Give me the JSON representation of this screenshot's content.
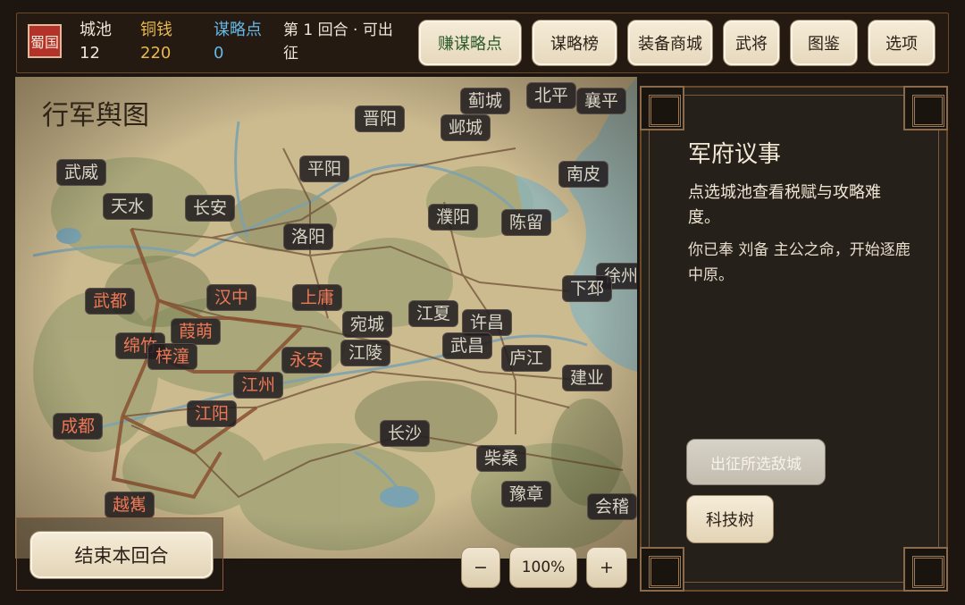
{
  "topbar": {
    "faction": "蜀国",
    "cities_label": "城池",
    "cities_value": "12",
    "coins_label": "铜钱",
    "coins_value": "220",
    "strategy_label": "谋略点",
    "strategy_value": "0",
    "turn_text": "第 1 回合 · 可出征",
    "buttons": {
      "earn": "赚谋略点",
      "rank": "谋略榜",
      "shop": "装备商城",
      "generals": "武将",
      "atlas": "图鉴",
      "options": "选项"
    }
  },
  "map": {
    "title": "行军舆图",
    "cities": [
      {
        "name": "蓟城",
        "side": "neutral"
      },
      {
        "name": "北平",
        "side": "neutral"
      },
      {
        "name": "襄平",
        "side": "neutral"
      },
      {
        "name": "晋阳",
        "side": "neutral"
      },
      {
        "name": "邺城",
        "side": "neutral"
      },
      {
        "name": "平阳",
        "side": "neutral"
      },
      {
        "name": "南皮",
        "side": "neutral"
      },
      {
        "name": "武威",
        "side": "neutral"
      },
      {
        "name": "天水",
        "side": "neutral"
      },
      {
        "name": "长安",
        "side": "neutral"
      },
      {
        "name": "洛阳",
        "side": "neutral"
      },
      {
        "name": "濮阳",
        "side": "neutral"
      },
      {
        "name": "陈留",
        "side": "neutral"
      },
      {
        "name": "徐州",
        "side": "neutral"
      },
      {
        "name": "下邳",
        "side": "neutral"
      },
      {
        "name": "武都",
        "side": "own"
      },
      {
        "name": "汉中",
        "side": "own"
      },
      {
        "name": "上庸",
        "side": "own"
      },
      {
        "name": "宛城",
        "side": "neutral"
      },
      {
        "name": "江夏",
        "side": "neutral"
      },
      {
        "name": "许昌",
        "side": "neutral"
      },
      {
        "name": "葭萌",
        "side": "own"
      },
      {
        "name": "绵竹",
        "side": "own"
      },
      {
        "name": "梓潼",
        "side": "own"
      },
      {
        "name": "永安",
        "side": "own"
      },
      {
        "name": "江陵",
        "side": "neutral"
      },
      {
        "name": "武昌",
        "side": "neutral"
      },
      {
        "name": "庐江",
        "side": "neutral"
      },
      {
        "name": "建业",
        "side": "neutral"
      },
      {
        "name": "江州",
        "side": "own"
      },
      {
        "name": "江阳",
        "side": "own"
      },
      {
        "name": "成都",
        "side": "own"
      },
      {
        "name": "长沙",
        "side": "neutral"
      },
      {
        "name": "柴桑",
        "side": "neutral"
      },
      {
        "name": "豫章",
        "side": "neutral"
      },
      {
        "name": "会稽",
        "side": "neutral"
      },
      {
        "name": "越嶲",
        "side": "own"
      }
    ]
  },
  "end_turn": "结束本回合",
  "zoom": {
    "out": "−",
    "level": "100%",
    "in": "+"
  },
  "panel": {
    "title": "军府议事",
    "hint": "点选城池查看税赋与攻略难度。",
    "message": "你已奉 刘备 主公之命，开始逐鹿中原。",
    "march_button": "出征所选敌城",
    "tech_button": "科技树"
  },
  "colors": {
    "own_city": "#ee7755",
    "neutral_city": "#d9d5c6",
    "accent": "#b3322a"
  }
}
